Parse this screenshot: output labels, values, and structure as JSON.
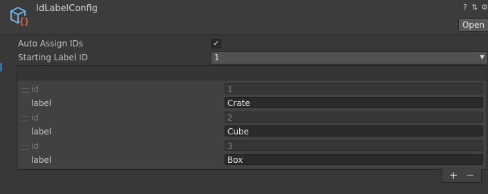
{
  "header": {
    "title": "IdLabelConfig",
    "icons": [
      "help-icon",
      "preset-icon",
      "settings-icon"
    ],
    "open_label": "Open"
  },
  "fields": {
    "auto_assign_label": "Auto Assign IDs",
    "auto_assign_checked": true,
    "starting_label": "Starting Label ID",
    "starting_value": "1"
  },
  "list": {
    "items": [
      {
        "id_label": "id",
        "id": "1",
        "label_label": "label",
        "label": "Crate"
      },
      {
        "id_label": "id",
        "id": "2",
        "label_label": "label",
        "label": "Cube"
      },
      {
        "id_label": "id",
        "id": "3",
        "label_label": "label",
        "label": "Box"
      }
    ],
    "add_symbol": "+",
    "remove_symbol": "−"
  }
}
